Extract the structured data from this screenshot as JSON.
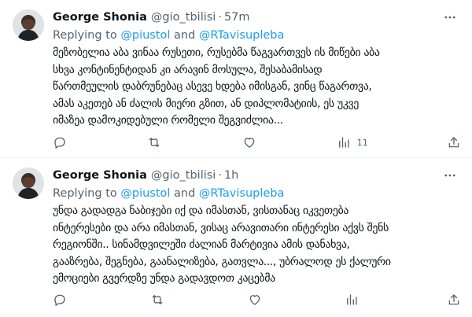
{
  "tweets": [
    {
      "author_name": "George Shonia",
      "handle": "@gio_tbilisi",
      "separator": "·",
      "time": "57m",
      "replying_prefix": "Replying to ",
      "mention_1": "@piustol",
      "replying_and": " and ",
      "mention_2": "@RTavisupleba",
      "lines": [
        "მეზობელია აბა ვინაა რუსეთი, რუსებმა წაგვართვეს ის მიწები აბა",
        "სხვა კონტინენტიდან კი არავინ მოსულა, შესაბამისად",
        "წართმეულის დაბრუნებაც ასევე ხდება იმისგან, ვინც წაგართვა,",
        "ამას აკეთებ ან ძალის მიერი გზით, ან დიპლომატიის, ეს უკვე",
        "იმაზეა დამოკიდებული რომელი შეგვიძლია..."
      ],
      "views_count": "11"
    },
    {
      "author_name": "George Shonia",
      "handle": "@gio_tbilisi",
      "separator": "·",
      "time": "1h",
      "replying_prefix": "Replying to ",
      "mention_1": "@piustol",
      "replying_and": " and ",
      "mention_2": "@RTavisupleba",
      "lines": [
        "უნდა გადადგა ნაბიჯები იქ და იმასთან, ვისთანაც იკვეთება",
        "ინტერესები და არა იმასთან, ვისაც არავითარი ინტერესი აქვს შენს",
        "რეგიონში.. სინამდვილეში ძალიან მარტივია ამის დანახვა,",
        "გააზრება, შეგნება, გაანალიზება, გათვლა..., უბრალოდ ეს ქალური",
        "ემოციები გვერდზე უნდა გადავდოთ კაცებმა"
      ],
      "views_count": ""
    }
  ],
  "icons": {
    "more": "more-horizontal-icon",
    "reply": "reply-icon",
    "retweet": "retweet-icon",
    "like": "like-icon",
    "views": "views-icon",
    "share": "share-icon"
  },
  "colors": {
    "link": "#1d9bf0",
    "secondary_text": "#536471",
    "primary_text": "#0f1419"
  }
}
